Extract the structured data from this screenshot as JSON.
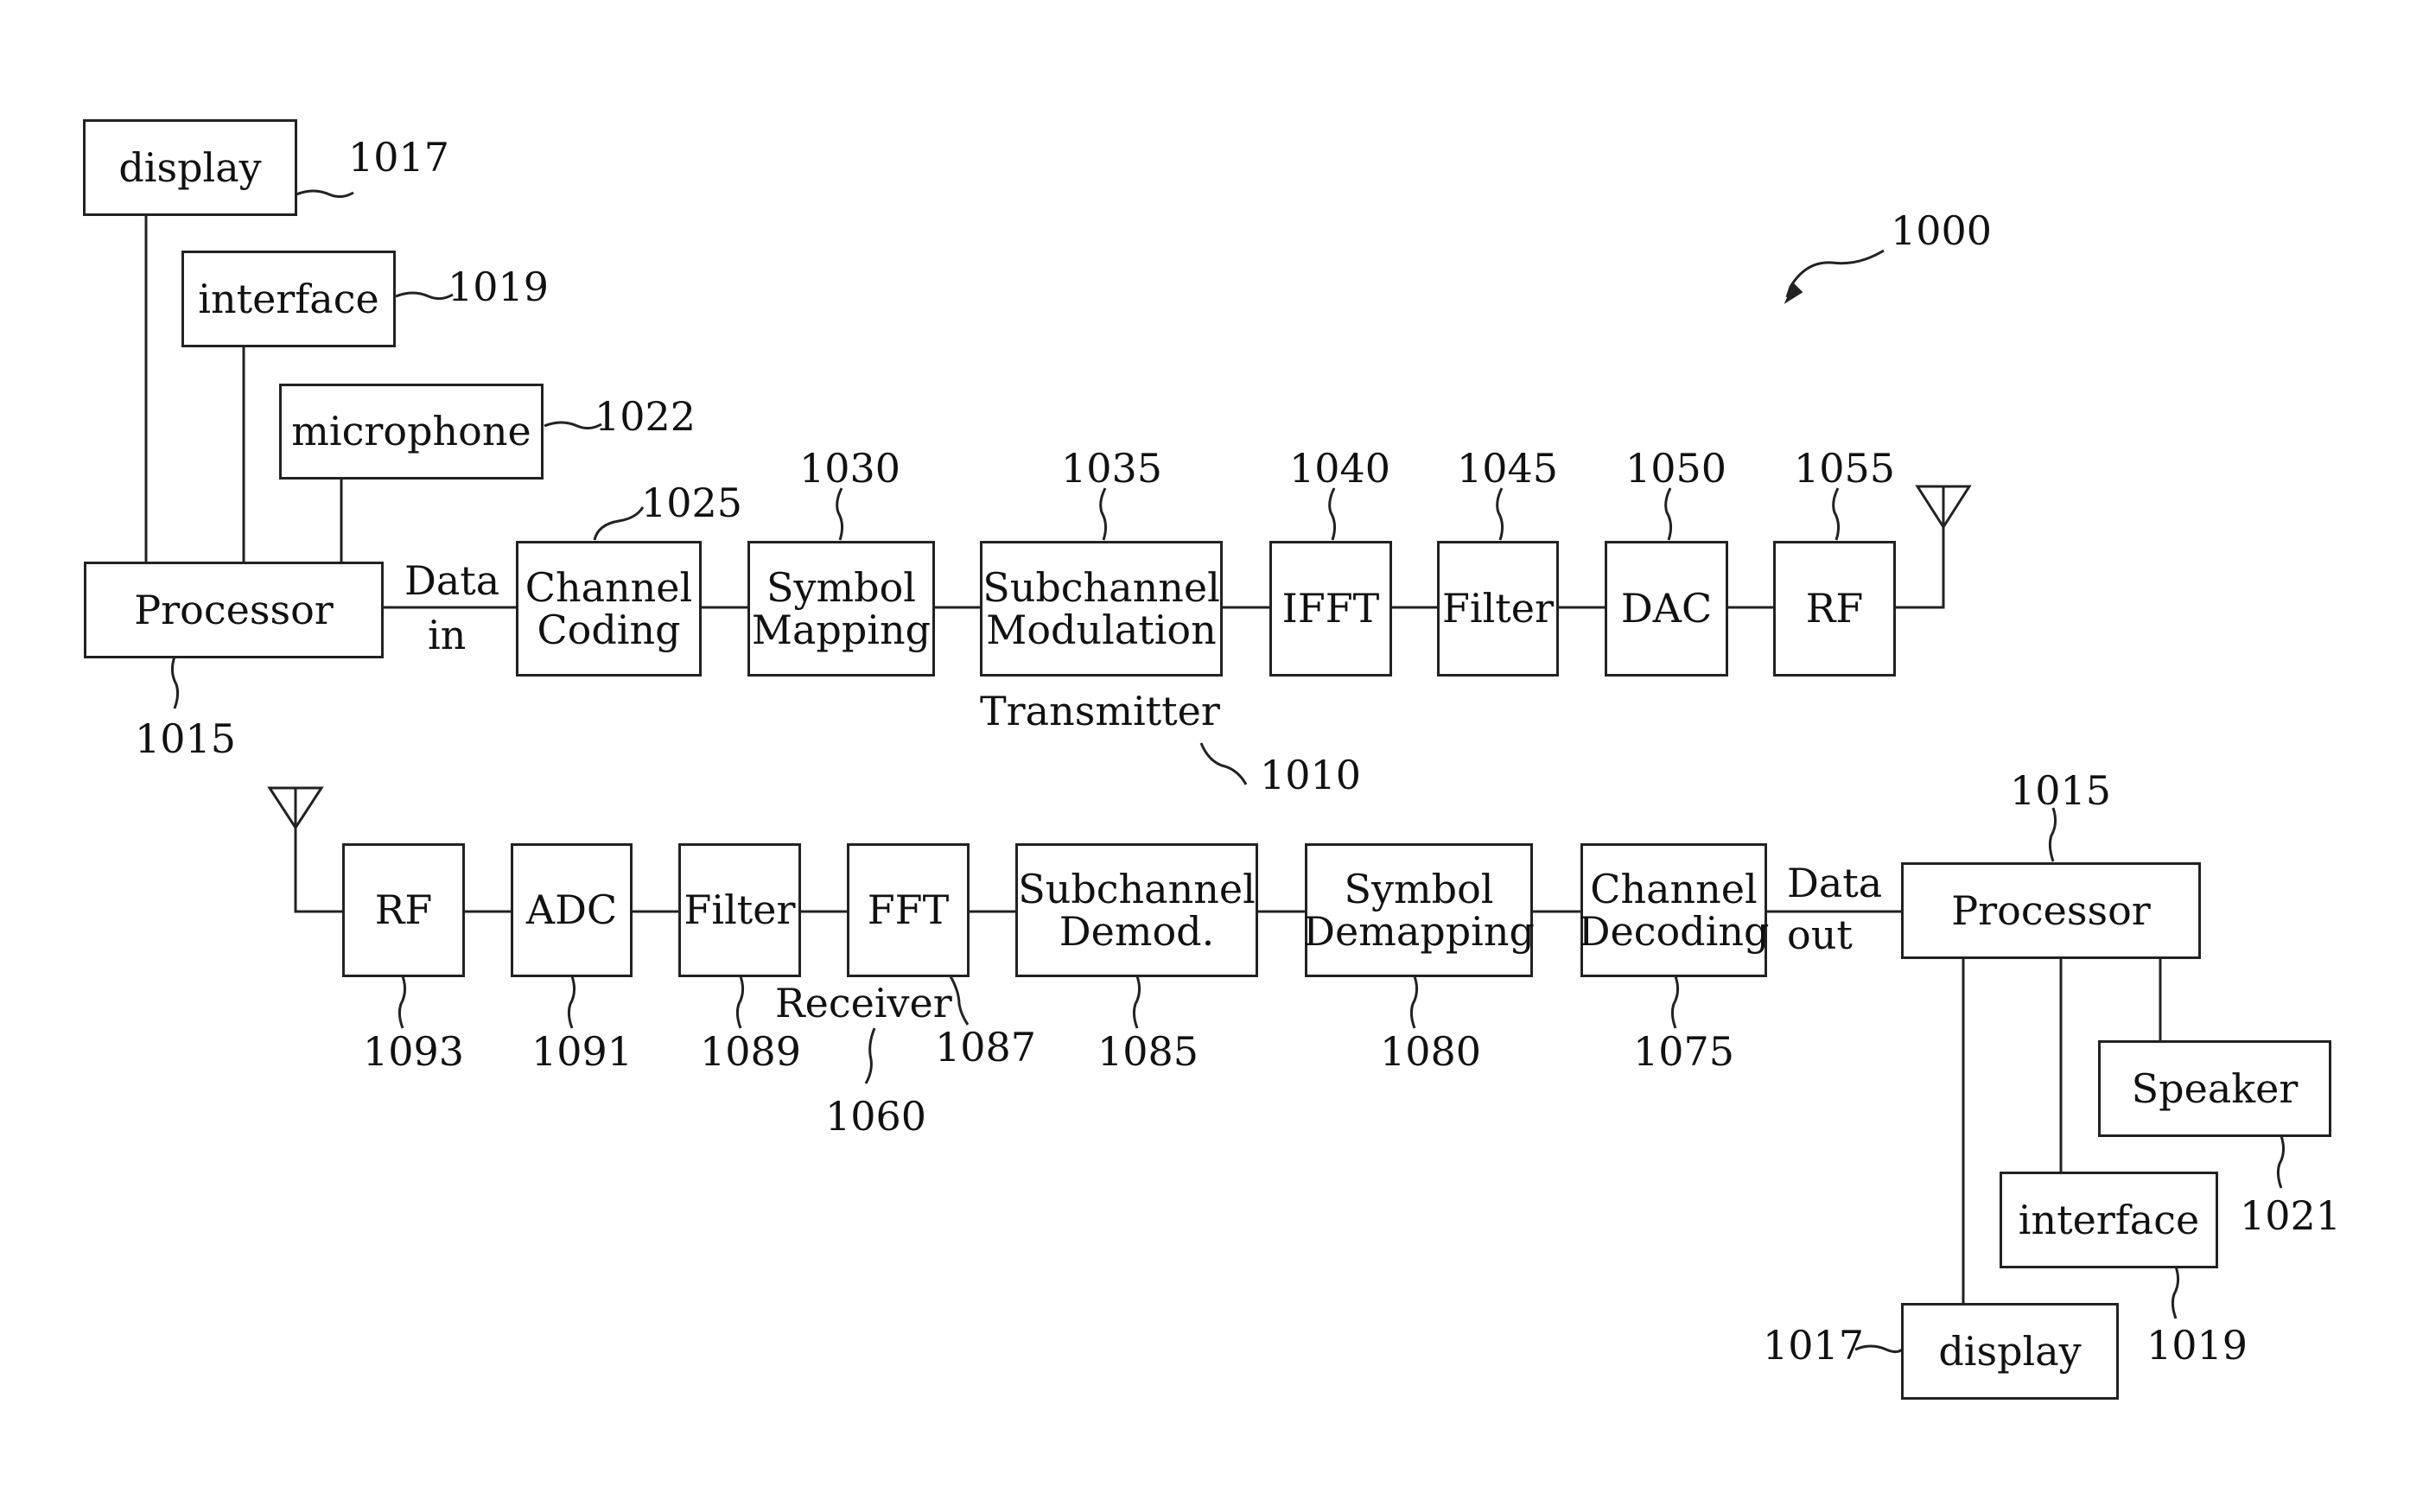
{
  "figure_ref": "1000",
  "transmitter": {
    "label": "Transmitter",
    "ref": "1010",
    "data_in": [
      "Data",
      "in"
    ],
    "processor": {
      "label": "Processor",
      "ref": "1015"
    },
    "peripherals": [
      {
        "label": "display",
        "ref": "1017"
      },
      {
        "label": "interface",
        "ref": "1019"
      },
      {
        "label": "microphone",
        "ref": "1022"
      }
    ],
    "blocks": [
      {
        "lines": [
          "Channel",
          "Coding"
        ],
        "ref": "1025"
      },
      {
        "lines": [
          "Symbol",
          "Mapping"
        ],
        "ref": "1030"
      },
      {
        "lines": [
          "Subchannel",
          "Modulation"
        ],
        "ref": "1035"
      },
      {
        "lines": [
          "IFFT"
        ],
        "ref": "1040"
      },
      {
        "lines": [
          "Filter"
        ],
        "ref": "1045"
      },
      {
        "lines": [
          "DAC"
        ],
        "ref": "1050"
      },
      {
        "lines": [
          "RF"
        ],
        "ref": "1055"
      }
    ]
  },
  "receiver": {
    "label": "Receiver",
    "ref": "1060",
    "data_out": [
      "Data",
      "out"
    ],
    "processor": {
      "label": "Processor",
      "ref": "1015"
    },
    "peripherals": [
      {
        "label": "Speaker",
        "ref": "1021"
      },
      {
        "label": "interface",
        "ref": "1019"
      },
      {
        "label": "display",
        "ref": "1017"
      }
    ],
    "blocks": [
      {
        "lines": [
          "RF"
        ],
        "ref": "1093"
      },
      {
        "lines": [
          "ADC"
        ],
        "ref": "1091"
      },
      {
        "lines": [
          "Filter"
        ],
        "ref": "1089"
      },
      {
        "lines": [
          "FFT"
        ],
        "ref": "1087"
      },
      {
        "lines": [
          "Subchannel",
          "Demod."
        ],
        "ref": "1085"
      },
      {
        "lines": [
          "Symbol",
          "Demapping"
        ],
        "ref": "1080"
      },
      {
        "lines": [
          "Channel",
          "Decoding"
        ],
        "ref": "1075"
      }
    ]
  }
}
